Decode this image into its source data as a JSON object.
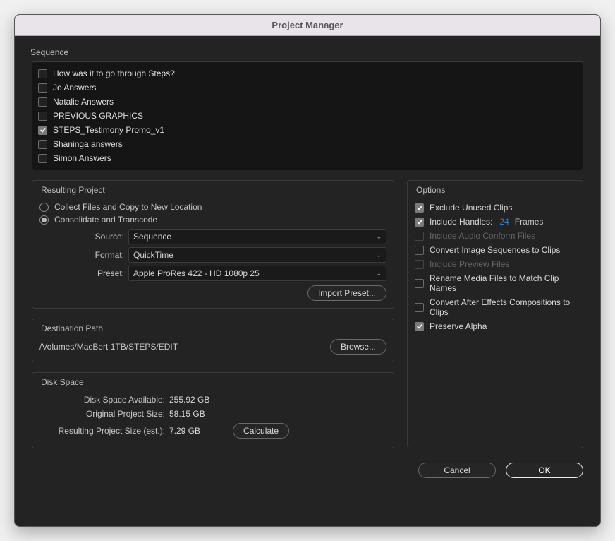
{
  "window": {
    "title": "Project Manager"
  },
  "sequence": {
    "title": "Sequence",
    "items": [
      {
        "label": "How was it to go through Steps?",
        "checked": false
      },
      {
        "label": "Jo Answers",
        "checked": false
      },
      {
        "label": "Natalie Answers",
        "checked": false
      },
      {
        "label": "PREVIOUS GRAPHICS",
        "checked": false
      },
      {
        "label": "STEPS_Testimony Promo_v1",
        "checked": true
      },
      {
        "label": "Shaninga answers",
        "checked": false
      },
      {
        "label": "Simon Answers",
        "checked": false
      }
    ]
  },
  "resulting": {
    "title": "Resulting Project",
    "radio_collect": "Collect Files and Copy to New Location",
    "radio_consolidate": "Consolidate and Transcode",
    "selected_radio": "consolidate",
    "source_label": "Source:",
    "source_value": "Sequence",
    "format_label": "Format:",
    "format_value": "QuickTime",
    "preset_label": "Preset:",
    "preset_value": "Apple ProRes 422 - HD 1080p 25",
    "import_preset_btn": "Import Preset..."
  },
  "destination": {
    "title": "Destination Path",
    "path": "/Volumes/MacBert 1TB/STEPS/EDIT",
    "browse_btn": "Browse..."
  },
  "diskspace": {
    "title": "Disk Space",
    "avail_label": "Disk Space Available:",
    "avail_value": "255.92 GB",
    "orig_label": "Original Project Size:",
    "orig_value": "58.15 GB",
    "est_label": "Resulting Project Size (est.):",
    "est_value": "7.29 GB",
    "calculate_btn": "Calculate"
  },
  "options": {
    "title": "Options",
    "items": [
      {
        "label": "Exclude Unused Clips",
        "checked": true,
        "disabled": false
      },
      {
        "label": "Include Handles:",
        "checked": true,
        "disabled": false,
        "handles_value": "24",
        "handles_suffix": "Frames"
      },
      {
        "label": "Include Audio Conform Files",
        "checked": false,
        "disabled": true
      },
      {
        "label": "Convert Image Sequences to Clips",
        "checked": false,
        "disabled": false
      },
      {
        "label": "Include Preview Files",
        "checked": false,
        "disabled": true
      },
      {
        "label": "Rename Media Files to Match Clip Names",
        "checked": false,
        "disabled": false
      },
      {
        "label": "Convert After Effects Compositions to Clips",
        "checked": false,
        "disabled": false
      },
      {
        "label": "Preserve Alpha",
        "checked": true,
        "disabled": false
      }
    ]
  },
  "footer": {
    "cancel": "Cancel",
    "ok": "OK"
  }
}
